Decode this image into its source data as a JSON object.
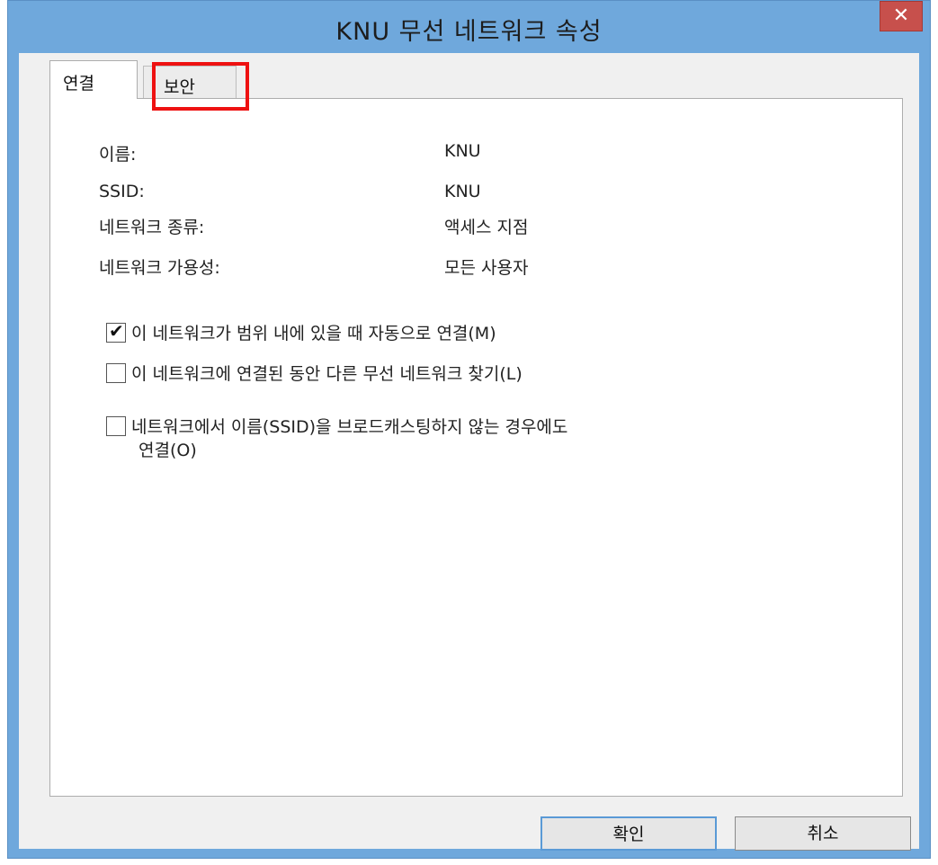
{
  "window": {
    "title": "KNU 무선 네트워크 속성",
    "close_label": "✕"
  },
  "tabs": [
    {
      "label": "연결",
      "selected": true
    },
    {
      "label": "보안",
      "selected": false,
      "highlighted": true
    }
  ],
  "properties": [
    {
      "label": "이름:",
      "value": "KNU"
    },
    {
      "label": "SSID:",
      "value": "KNU"
    },
    {
      "label": "네트워크 종류:",
      "value": "액세스 지점"
    },
    {
      "label": "네트워크 가용성:",
      "value": "모든 사용자"
    }
  ],
  "options": [
    {
      "label": "이 네트워크가 범위 내에 있을 때 자동으로 연결(M)",
      "checked": true
    },
    {
      "label": "이 네트워크에 연결된 동안 다른 무선 네트워크 찾기(L)",
      "checked": false
    },
    {
      "label_line1": "네트워크에서 이름(SSID)을 브로드캐스팅하지 않는 경우에도",
      "label_line2": "연결(O)",
      "checked": false
    }
  ],
  "buttons": {
    "ok": "확인",
    "cancel": "취소"
  },
  "colors": {
    "frame": "#6fa8dc",
    "close_button": "#c7504c",
    "highlight": "#ee1111"
  }
}
